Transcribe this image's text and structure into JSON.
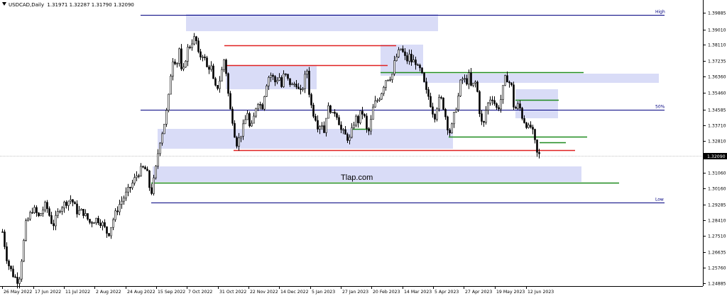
{
  "header": {
    "symbol": "USDCAD,Daily",
    "ohlc": "1.31971 1.32287 1.31790 1.32090"
  },
  "chart_data": {
    "type": "candlestick",
    "y_axis": {
      "position": "right",
      "range": [
        1.2488,
        1.403
      ],
      "ticks": [
        "1.39885",
        "1.39010",
        "1.38110",
        "1.37235",
        "1.36360",
        "1.35460",
        "1.34585",
        "1.33710",
        "1.32810",
        "1.31935",
        "1.31060",
        "1.30160",
        "1.29285",
        "1.28410",
        "1.27510",
        "1.26635",
        "1.25760",
        "1.24885"
      ],
      "current_price": "1.32090"
    },
    "x_axis": {
      "ticks": [
        "26 May 2022",
        "17 Jun 2022",
        "11 Jul 2022",
        "2 Aug 2022",
        "24 Aug 2022",
        "15 Sep 2022",
        "7 Oct 2022",
        "31 Oct 2022",
        "22 Nov 2022",
        "14 Dec 2022",
        "5 Jan 2023",
        "27 Jan 2023",
        "20 Feb 2023",
        "14 Mar 2023",
        "5 Apr 2023",
        "27 Apr 2023",
        "19 May 2023",
        "12 Jun 2023"
      ]
    },
    "watermark": "Tlap.com",
    "levels": [
      {
        "label": "High",
        "price": 1.3988,
        "color": "#000080"
      },
      {
        "label": "50%",
        "price": 1.3463,
        "color": "#000080"
      },
      {
        "label": "Low",
        "price": 1.295,
        "color": "#000080"
      }
    ],
    "price_path": [
      [
        0,
        1.286
      ],
      [
        10,
        1.262
      ],
      [
        18,
        1.255
      ],
      [
        26,
        1.251
      ],
      [
        36,
        1.283
      ],
      [
        46,
        1.292
      ],
      [
        54,
        1.287
      ],
      [
        64,
        1.294
      ],
      [
        74,
        1.282
      ],
      [
        84,
        1.292
      ],
      [
        92,
        1.295
      ],
      [
        100,
        1.297
      ],
      [
        108,
        1.29
      ],
      [
        116,
        1.29
      ],
      [
        126,
        1.284
      ],
      [
        136,
        1.286
      ],
      [
        144,
        1.283
      ],
      [
        152,
        1.277
      ],
      [
        160,
        1.287
      ],
      [
        168,
        1.294
      ],
      [
        176,
        1.299
      ],
      [
        184,
        1.304
      ],
      [
        192,
        1.31
      ],
      [
        200,
        1.314
      ],
      [
        206,
        1.313
      ],
      [
        212,
        1.299
      ],
      [
        218,
        1.311
      ],
      [
        224,
        1.328
      ],
      [
        230,
        1.337
      ],
      [
        236,
        1.349
      ],
      [
        240,
        1.366
      ],
      [
        244,
        1.377
      ],
      [
        248,
        1.37
      ],
      [
        252,
        1.38
      ],
      [
        256,
        1.363
      ],
      [
        260,
        1.373
      ],
      [
        264,
        1.38
      ],
      [
        268,
        1.382
      ],
      [
        272,
        1.386
      ],
      [
        276,
        1.384
      ],
      [
        280,
        1.374
      ],
      [
        284,
        1.378
      ],
      [
        288,
        1.374
      ],
      [
        292,
        1.368
      ],
      [
        296,
        1.372
      ],
      [
        300,
        1.362
      ],
      [
        304,
        1.357
      ],
      [
        308,
        1.361
      ],
      [
        312,
        1.368
      ],
      [
        316,
        1.376
      ],
      [
        320,
        1.358
      ],
      [
        324,
        1.346
      ],
      [
        328,
        1.339
      ],
      [
        332,
        1.327
      ],
      [
        336,
        1.33
      ],
      [
        340,
        1.334
      ],
      [
        344,
        1.339
      ],
      [
        348,
        1.345
      ],
      [
        352,
        1.334
      ],
      [
        356,
        1.34
      ],
      [
        360,
        1.348
      ],
      [
        364,
        1.352
      ],
      [
        368,
        1.346
      ],
      [
        372,
        1.355
      ],
      [
        376,
        1.363
      ],
      [
        380,
        1.366
      ],
      [
        384,
        1.364
      ],
      [
        388,
        1.361
      ],
      [
        392,
        1.366
      ],
      [
        396,
        1.359
      ],
      [
        400,
        1.367
      ],
      [
        404,
        1.363
      ],
      [
        408,
        1.361
      ],
      [
        412,
        1.359
      ],
      [
        416,
        1.362
      ],
      [
        420,
        1.357
      ],
      [
        424,
        1.355
      ],
      [
        428,
        1.363
      ],
      [
        432,
        1.368
      ],
      [
        436,
        1.352
      ],
      [
        440,
        1.345
      ],
      [
        444,
        1.342
      ],
      [
        448,
        1.336
      ],
      [
        452,
        1.34
      ],
      [
        456,
        1.334
      ],
      [
        460,
        1.346
      ],
      [
        464,
        1.348
      ],
      [
        468,
        1.343
      ],
      [
        472,
        1.346
      ],
      [
        476,
        1.341
      ],
      [
        480,
        1.335
      ],
      [
        484,
        1.333
      ],
      [
        488,
        1.331
      ],
      [
        492,
        1.33
      ],
      [
        496,
        1.336
      ],
      [
        500,
        1.342
      ],
      [
        504,
        1.34
      ],
      [
        508,
        1.345
      ],
      [
        512,
        1.344
      ],
      [
        516,
        1.335
      ],
      [
        520,
        1.334
      ],
      [
        524,
        1.346
      ],
      [
        528,
        1.35
      ],
      [
        532,
        1.352
      ],
      [
        536,
        1.355
      ],
      [
        540,
        1.36
      ],
      [
        544,
        1.364
      ],
      [
        548,
        1.364
      ],
      [
        552,
        1.366
      ],
      [
        556,
        1.374
      ],
      [
        560,
        1.377
      ],
      [
        564,
        1.38
      ],
      [
        568,
        1.377
      ],
      [
        572,
        1.373
      ],
      [
        576,
        1.376
      ],
      [
        580,
        1.372
      ],
      [
        584,
        1.374
      ],
      [
        588,
        1.369
      ],
      [
        592,
        1.368
      ],
      [
        596,
        1.362
      ],
      [
        600,
        1.356
      ],
      [
        604,
        1.353
      ],
      [
        608,
        1.346
      ],
      [
        612,
        1.343
      ],
      [
        616,
        1.35
      ],
      [
        620,
        1.353
      ],
      [
        624,
        1.348
      ],
      [
        628,
        1.341
      ],
      [
        632,
        1.333
      ],
      [
        636,
        1.337
      ],
      [
        640,
        1.345
      ],
      [
        644,
        1.351
      ],
      [
        648,
        1.361
      ],
      [
        652,
        1.364
      ],
      [
        656,
        1.361
      ],
      [
        660,
        1.365
      ],
      [
        664,
        1.357
      ],
      [
        668,
        1.363
      ],
      [
        672,
        1.356
      ],
      [
        676,
        1.342
      ],
      [
        680,
        1.336
      ],
      [
        684,
        1.346
      ],
      [
        688,
        1.351
      ],
      [
        692,
        1.354
      ],
      [
        696,
        1.35
      ],
      [
        700,
        1.346
      ],
      [
        704,
        1.35
      ],
      [
        708,
        1.358
      ],
      [
        712,
        1.365
      ],
      [
        716,
        1.362
      ],
      [
        720,
        1.359
      ],
      [
        724,
        1.345
      ],
      [
        728,
        1.349
      ],
      [
        732,
        1.347
      ],
      [
        736,
        1.341
      ],
      [
        740,
        1.339
      ],
      [
        744,
        1.336
      ],
      [
        748,
        1.337
      ],
      [
        752,
        1.33
      ],
      [
        756,
        1.322
      ],
      [
        760,
        1.3209
      ]
    ]
  },
  "colors": {
    "zone_fill": "#d9dcf7",
    "support_line": "#1e8a1e",
    "resistance_line": "#e02020",
    "level_line": "#2b2b7a",
    "candle": "#000000",
    "price_label_bg": "#000000",
    "price_label_text": "#ffffff"
  }
}
